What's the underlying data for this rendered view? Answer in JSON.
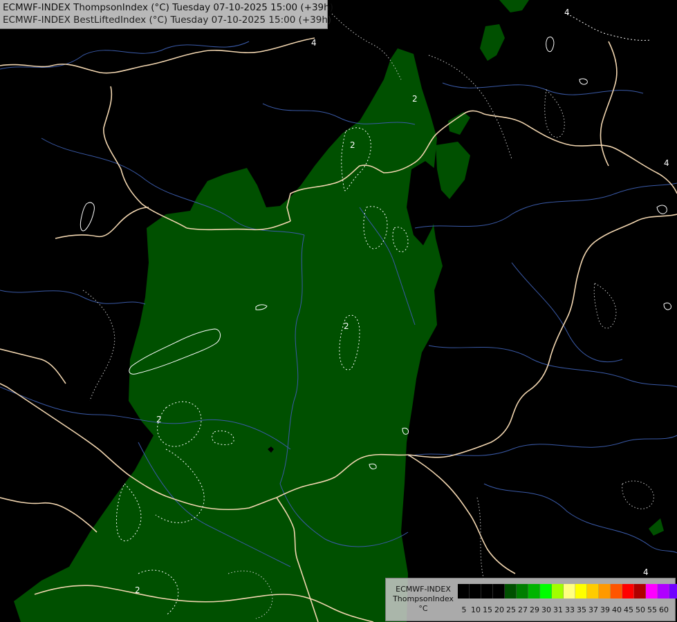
{
  "header": {
    "line1": "ECMWF-INDEX ThompsonIndex (°C) Tuesday 07-10-2025 15:00 (+39h)",
    "line2": "ECMWF-INDEX BestLiftedIndex (°C) Tuesday 07-10-2025 15:00 (+39h)"
  },
  "legend": {
    "source": "ECMWF-INDEX",
    "variable": "ThompsonIndex",
    "unit": "°C",
    "ticks": [
      "5",
      "10",
      "15",
      "20",
      "25",
      "27",
      "29",
      "30",
      "31",
      "33",
      "35",
      "37",
      "39",
      "40",
      "45",
      "50",
      "55",
      "60"
    ],
    "colors": [
      "#000000",
      "#000000",
      "#000000",
      "#000000",
      "#005000",
      "#007e00",
      "#00b400",
      "#00ff00",
      "#a0ff00",
      "#ffff80",
      "#ffff00",
      "#ffcc00",
      "#ff9900",
      "#ff5500",
      "#ff0000",
      "#b00000",
      "#ff00ff",
      "#b000ff",
      "#7000ff",
      "#0000ff"
    ]
  },
  "contour_labels": [
    "2",
    "2",
    "2",
    "2",
    "2",
    "4",
    "4",
    "4",
    "4"
  ],
  "colors": {
    "background": "#000000",
    "shade_20_25": "#005000",
    "border": "#f2d6b0",
    "river": "#3a5aa8",
    "contour": "#ffffff"
  }
}
